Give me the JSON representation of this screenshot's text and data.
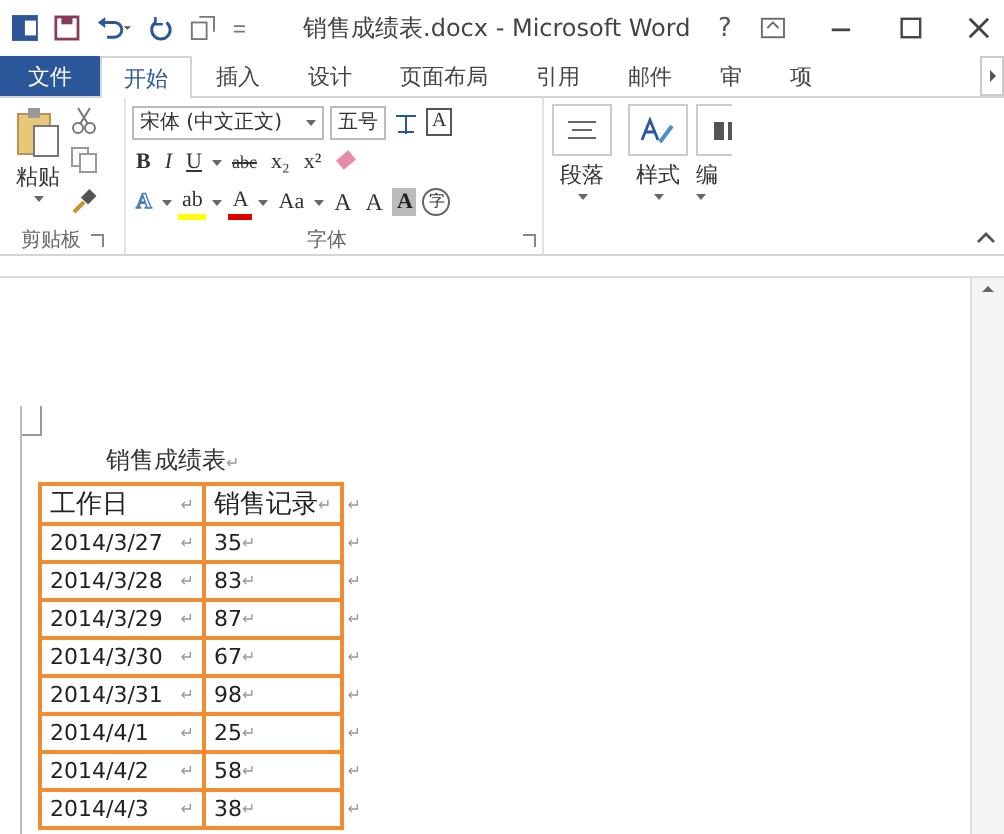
{
  "window": {
    "title": "销售成绩表.docx - Microsoft Word",
    "help": "?"
  },
  "tabs": [
    {
      "label": "文件",
      "kind": "file",
      "selected": false
    },
    {
      "label": "开始",
      "kind": "tab",
      "selected": true
    },
    {
      "label": "插入",
      "kind": "tab",
      "selected": false
    },
    {
      "label": "设计",
      "kind": "tab",
      "selected": false
    },
    {
      "label": "页面布局",
      "kind": "tab",
      "selected": false
    },
    {
      "label": "引用",
      "kind": "tab",
      "selected": false
    },
    {
      "label": "邮件",
      "kind": "tab",
      "selected": false
    },
    {
      "label": "审",
      "kind": "tab",
      "selected": false
    },
    {
      "label": "项",
      "kind": "tab",
      "selected": false
    }
  ],
  "ribbon": {
    "clipboard": {
      "paste": "粘贴",
      "label": "剪贴板"
    },
    "font": {
      "face": "宋体 (中文正文)",
      "size": "五号",
      "label": "字体",
      "row2": [
        {
          "text": "B",
          "kind": "bold"
        },
        {
          "text": "I",
          "kind": "italic"
        },
        {
          "text": "U",
          "kind": "underline"
        },
        {
          "text": "abc",
          "kind": "strike"
        },
        {
          "text": "x₂",
          "kind": "sub"
        },
        {
          "text": "x²",
          "kind": "sup"
        }
      ],
      "row3": [
        {
          "text": "A",
          "kind": "outline"
        },
        {
          "text": "ab",
          "kind": "highlight"
        },
        {
          "text": "A",
          "kind": "color"
        },
        {
          "text": "Aa",
          "kind": "case"
        },
        {
          "text": "A",
          "kind": "grow"
        },
        {
          "text": "A",
          "kind": "shrink"
        },
        {
          "text": "A",
          "kind": "shaded"
        },
        {
          "text": "字",
          "kind": "circle"
        }
      ],
      "boxed": "A"
    },
    "groups": [
      {
        "label": "段落",
        "kind": "paragraph"
      },
      {
        "label": "样式",
        "kind": "styles"
      },
      {
        "label": "编",
        "kind": "editing"
      }
    ]
  },
  "document": {
    "title": "销售成绩表",
    "title_mark": "↵",
    "row_mark": "↵",
    "columns": [
      {
        "text": "工作日",
        "mark": "↵"
      },
      {
        "text": "销售记录",
        "mark": "↵"
      }
    ],
    "rows": [
      [
        {
          "text": "2014/3/27",
          "mark": "↵"
        },
        {
          "text": "35",
          "mark": "↵"
        }
      ],
      [
        {
          "text": "2014/3/28",
          "mark": "↵"
        },
        {
          "text": "83",
          "mark": "↵"
        }
      ],
      [
        {
          "text": "2014/3/29",
          "mark": "↵"
        },
        {
          "text": "87",
          "mark": "↵"
        }
      ],
      [
        {
          "text": "2014/3/30",
          "mark": "↵"
        },
        {
          "text": "67",
          "mark": "↵"
        }
      ],
      [
        {
          "text": "2014/3/31",
          "mark": "↵"
        },
        {
          "text": "98",
          "mark": "↵"
        }
      ],
      [
        {
          "text": "2014/4/1",
          "mark": "↵"
        },
        {
          "text": "25",
          "mark": "↵"
        }
      ],
      [
        {
          "text": "2014/4/2",
          "mark": "↵"
        },
        {
          "text": "58",
          "mark": "↵"
        }
      ],
      [
        {
          "text": "2014/4/3",
          "mark": "↵"
        },
        {
          "text": "38",
          "mark": "↵"
        }
      ]
    ]
  }
}
